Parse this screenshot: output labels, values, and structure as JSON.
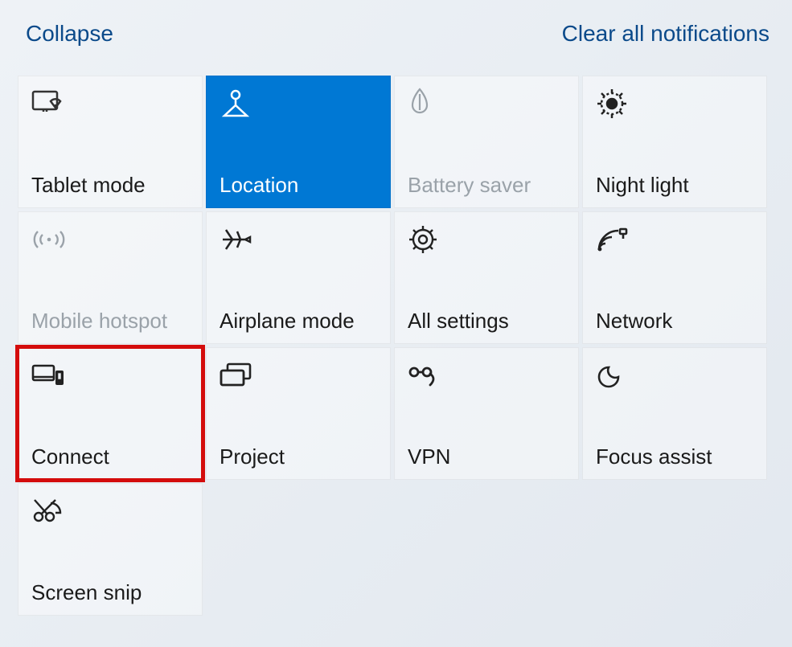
{
  "header": {
    "collapse": "Collapse",
    "clear": "Clear all notifications"
  },
  "tiles": {
    "tablet": {
      "label": "Tablet mode"
    },
    "location": {
      "label": "Location"
    },
    "battery": {
      "label": "Battery saver"
    },
    "night": {
      "label": "Night light"
    },
    "hotspot": {
      "label": "Mobile hotspot"
    },
    "airplane": {
      "label": "Airplane mode"
    },
    "settings": {
      "label": "All settings"
    },
    "network": {
      "label": "Network"
    },
    "connect": {
      "label": "Connect"
    },
    "project": {
      "label": "Project"
    },
    "vpn": {
      "label": "VPN"
    },
    "focus": {
      "label": "Focus assist"
    },
    "snip": {
      "label": "Screen snip"
    }
  }
}
